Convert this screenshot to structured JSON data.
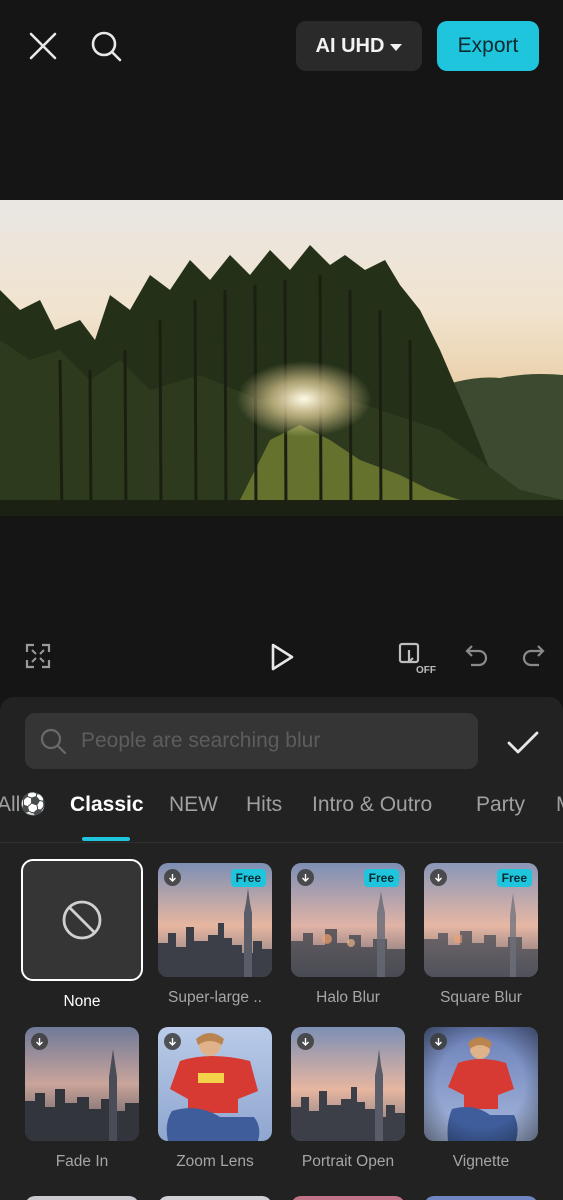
{
  "topbar": {
    "close_icon": "close-icon",
    "search_icon": "search-icon",
    "quality_label": "AI UHD",
    "export_label": "Export"
  },
  "controls": {
    "fullscreen_icon": "fullscreen-icon",
    "play_icon": "play-icon",
    "keyframe_toggle_icon": "keyframe-off-icon",
    "keyframe_toggle_text": "OFF",
    "undo_icon": "undo-icon",
    "redo_icon": "redo-icon"
  },
  "panel": {
    "search_placeholder": "People are searching blur",
    "confirm_icon": "checkmark-icon",
    "tabs": [
      {
        "label": "All⚽"
      },
      {
        "label": "Classic"
      },
      {
        "label": "NEW"
      },
      {
        "label": "Hits"
      },
      {
        "label": "Intro & Outro"
      },
      {
        "label": "Party"
      },
      {
        "label": "M"
      }
    ],
    "active_tab": "Classic",
    "none_label": "None",
    "effects": [
      {
        "label": "Super-large ..",
        "free": "Free"
      },
      {
        "label": "Halo Blur",
        "free": "Free"
      },
      {
        "label": "Square Blur",
        "free": "Free"
      },
      {
        "label": "Fade In"
      },
      {
        "label": "Zoom Lens"
      },
      {
        "label": "Portrait Open"
      },
      {
        "label": "Vignette"
      }
    ]
  },
  "colors": {
    "accent": "#1ec5dd",
    "background": "#151515",
    "panel": "#222222"
  }
}
